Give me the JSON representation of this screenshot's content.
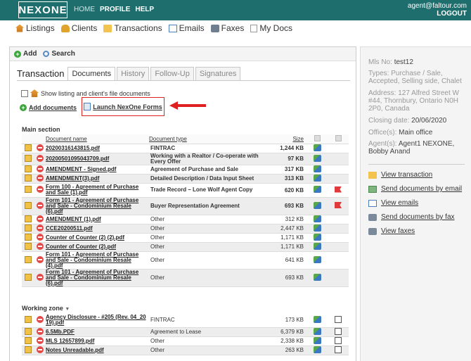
{
  "topbar": {
    "logo": "NEXONE",
    "nav": [
      "HOME",
      "PROFILE",
      "HELP"
    ],
    "user_email": "agent@faltour.com",
    "logout": "LOGOUT"
  },
  "menubar": {
    "items": [
      {
        "label": "Listings",
        "icon": "house-icon"
      },
      {
        "label": "Clients",
        "icon": "people-icon"
      },
      {
        "label": "Transactions",
        "icon": "folder-icon"
      },
      {
        "label": "Emails",
        "icon": "mail-icon"
      },
      {
        "label": "Faxes",
        "icon": "fax-icon"
      },
      {
        "label": "My Docs",
        "icon": "document-icon"
      }
    ]
  },
  "toolbar": {
    "add": "Add",
    "search": "Search"
  },
  "tabs": {
    "title": "Transaction",
    "items": [
      "Documents",
      "History",
      "Follow-Up",
      "Signatures"
    ]
  },
  "documents": {
    "show_listing_label": "Show listing and client's file documents",
    "add_documents": "Add documents",
    "launch_forms": "Launch NexOne Forms",
    "main_section": "Main section",
    "columns": {
      "name": "Document name",
      "type": "Document type",
      "size": "Size"
    },
    "main_rows": [
      {
        "name": "20200316143815.pdf",
        "type": "FINTRAC",
        "size": "1,244 KB",
        "bold": true,
        "flag": false
      },
      {
        "name": "20200501095043709.pdf",
        "type": "Working with a Realtor / Co-operate with Every Offer",
        "size": "97 KB",
        "bold": true,
        "flag": false
      },
      {
        "name": "AMENDMENT - Signed.pdf",
        "type": "Agreement of Purchase and Sale",
        "size": "317 KB",
        "bold": true,
        "flag": false
      },
      {
        "name": "AMENDMENT(3).pdf",
        "type": "Detailed Description / Data Input Sheet",
        "size": "313 KB",
        "bold": true,
        "flag": false
      },
      {
        "name": "Form 100 - Agreement of Purchase and Sale (1).pdf",
        "type": "Trade Record – Lone Wolf Agent Copy",
        "size": "620 KB",
        "bold": true,
        "flag": true
      },
      {
        "name": "Form 101 - Agreement of Purchase and Sale - Condominium Resale (6).pdf",
        "type": "Buyer Representation Agreement",
        "size": "693 KB",
        "bold": true,
        "flag": true
      },
      {
        "name": "AMENDMENT (1).pdf",
        "type": "Other",
        "size": "312 KB",
        "bold": false,
        "flag": false
      },
      {
        "name": "CCE20200511.pdf",
        "type": "Other",
        "size": "2,447 KB",
        "bold": false,
        "flag": false
      },
      {
        "name": "Counter of Counter (2) (2).pdf",
        "type": "Other",
        "size": "1,171 KB",
        "bold": false,
        "flag": false
      },
      {
        "name": "Counter of Counter (2).pdf",
        "type": "Other",
        "size": "1,171 KB",
        "bold": false,
        "flag": false
      },
      {
        "name": "Form 101 - Agreement of Purchase and Sale - Condominium Resale (4).pdf",
        "type": "Other",
        "size": "641 KB",
        "bold": false,
        "flag": false
      },
      {
        "name": "Form 101 - Agreement of Purchase and Sale - Condominium Resale (6).pdf",
        "type": "Other",
        "size": "693 KB",
        "bold": false,
        "flag": false
      }
    ],
    "working_zone": "Working zone",
    "working_rows": [
      {
        "name": "Agency Disclosure - #205 (Rev. 04_20 19).pdf",
        "type": "FINTRAC",
        "size": "173 KB"
      },
      {
        "name": "6.5Mb.PDF",
        "type": "Agreement to Lease",
        "size": "6,379 KB"
      },
      {
        "name": "MLS 12657899.pdf",
        "type": "Other",
        "size": "2,338 KB"
      },
      {
        "name": "Notes Unreadable.pdf",
        "type": "Other",
        "size": "263 KB"
      }
    ]
  },
  "side": {
    "mls_label": "Mls No:",
    "mls_value": "test12",
    "types_label": "Types:",
    "types_value": "Purchase / Sale, Accepted, Selling side, Chalet",
    "address_label": "Address:",
    "address_value": "127 Alfred Street W #44, Thornbury, Ontario N0H 2P0, Canada",
    "closing_label": "Closing date:",
    "closing_value": "20/06/2020",
    "office_label": "Office(s):",
    "office_value": "Main office",
    "agents_label": "Agent(s):",
    "agents_value": "Agent1 NEXONE, Bobby Anand",
    "actions": [
      "View transaction",
      "Send documents by email",
      "View emails",
      "Send documents by fax",
      "View faxes"
    ]
  }
}
